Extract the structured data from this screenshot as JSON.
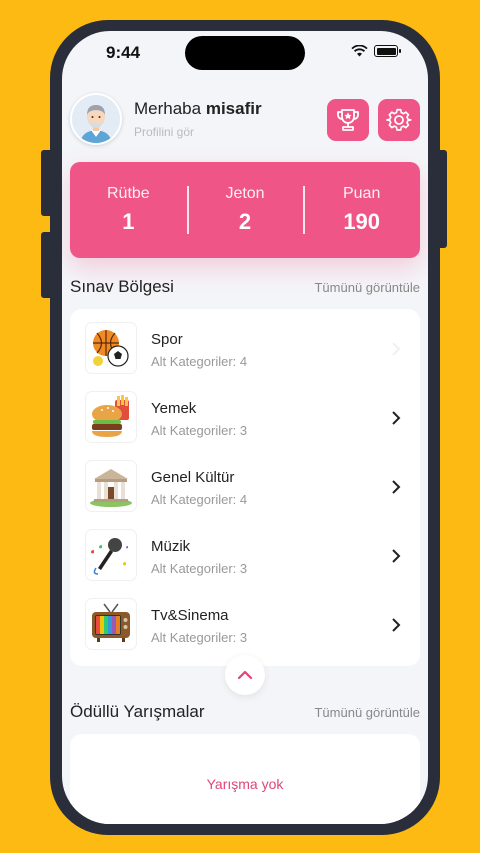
{
  "status_bar": {
    "time": "9:44"
  },
  "header": {
    "greeting_prefix": "Merhaba",
    "username": "misafir",
    "subtitle": "Profilini gör",
    "trophy_icon": "trophy-icon",
    "settings_icon": "gear-icon"
  },
  "stats": [
    {
      "label": "Rütbe",
      "value": "1"
    },
    {
      "label": "Jeton",
      "value": "2"
    },
    {
      "label": "Puan",
      "value": "190"
    }
  ],
  "exam_section": {
    "title": "Sınav Bölgesi",
    "view_all": "Tümünü görüntüle",
    "categories": [
      {
        "name": "Spor",
        "sub": "Alt Kategoriler: 4",
        "icon": "sports-balls-icon"
      },
      {
        "name": "Yemek",
        "sub": "Alt Kategoriler: 3",
        "icon": "food-icon"
      },
      {
        "name": "Genel Kültür",
        "sub": "Alt Kategoriler: 4",
        "icon": "museum-icon"
      },
      {
        "name": "Müzik",
        "sub": "Alt Kategoriler: 3",
        "icon": "microphone-icon"
      },
      {
        "name": "Tv&Sinema",
        "sub": "Alt Kategoriler: 3",
        "icon": "tv-icon"
      }
    ]
  },
  "contest_section": {
    "title": "Ödüllü Yarışmalar",
    "view_all": "Tümünü görüntüle",
    "empty": "Yarışma yok"
  },
  "colors": {
    "accent": "#EF5687",
    "background": "#FDBA12",
    "phone_frame": "#2a2d3a"
  }
}
